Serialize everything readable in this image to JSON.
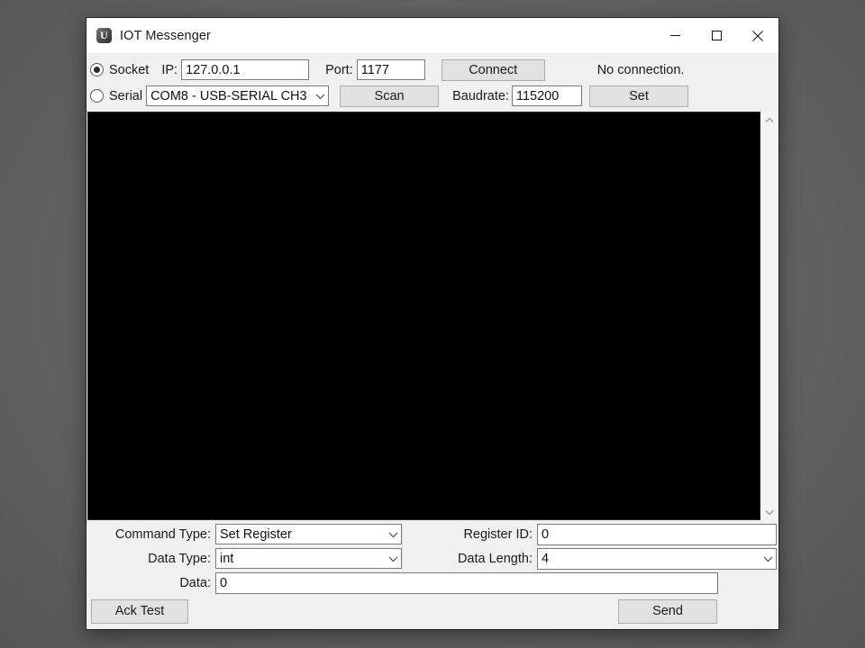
{
  "window": {
    "title": "IOT Messenger",
    "app_icon": "u-logo-icon",
    "minimize_label": "—",
    "maximize_label": "□",
    "close_label": "✕"
  },
  "toolbar": {
    "socket": {
      "radio_label": "Socket",
      "selected": true,
      "ip_label": "IP:",
      "ip_value": "127.0.0.1",
      "port_label": "Port:",
      "port_value": "1177",
      "connect_button": "Connect"
    },
    "serial": {
      "radio_label": "Serial",
      "selected": false,
      "port_value": "COM8 - USB-SERIAL CH3",
      "scan_button": "Scan",
      "baudrate_label": "Baudrate:",
      "baudrate_value": "115200",
      "set_button": "Set"
    },
    "status": "No connection."
  },
  "console": {
    "content": "",
    "background_color": "#000000"
  },
  "scrollbar": {
    "up_arrow": "scroll-up-icon",
    "down_arrow": "scroll-down-icon"
  },
  "form": {
    "command_type_label": "Command Type:",
    "command_type_value": "Set Register",
    "data_type_label": "Data Type:",
    "data_type_value": "int",
    "data_label": "Data:",
    "data_value": "0",
    "register_id_label": "Register ID:",
    "register_id_value": "0",
    "data_length_label": "Data Length:",
    "data_length_value": "4"
  },
  "footer": {
    "ack_test_button": "Ack Test",
    "send_button": "Send"
  }
}
